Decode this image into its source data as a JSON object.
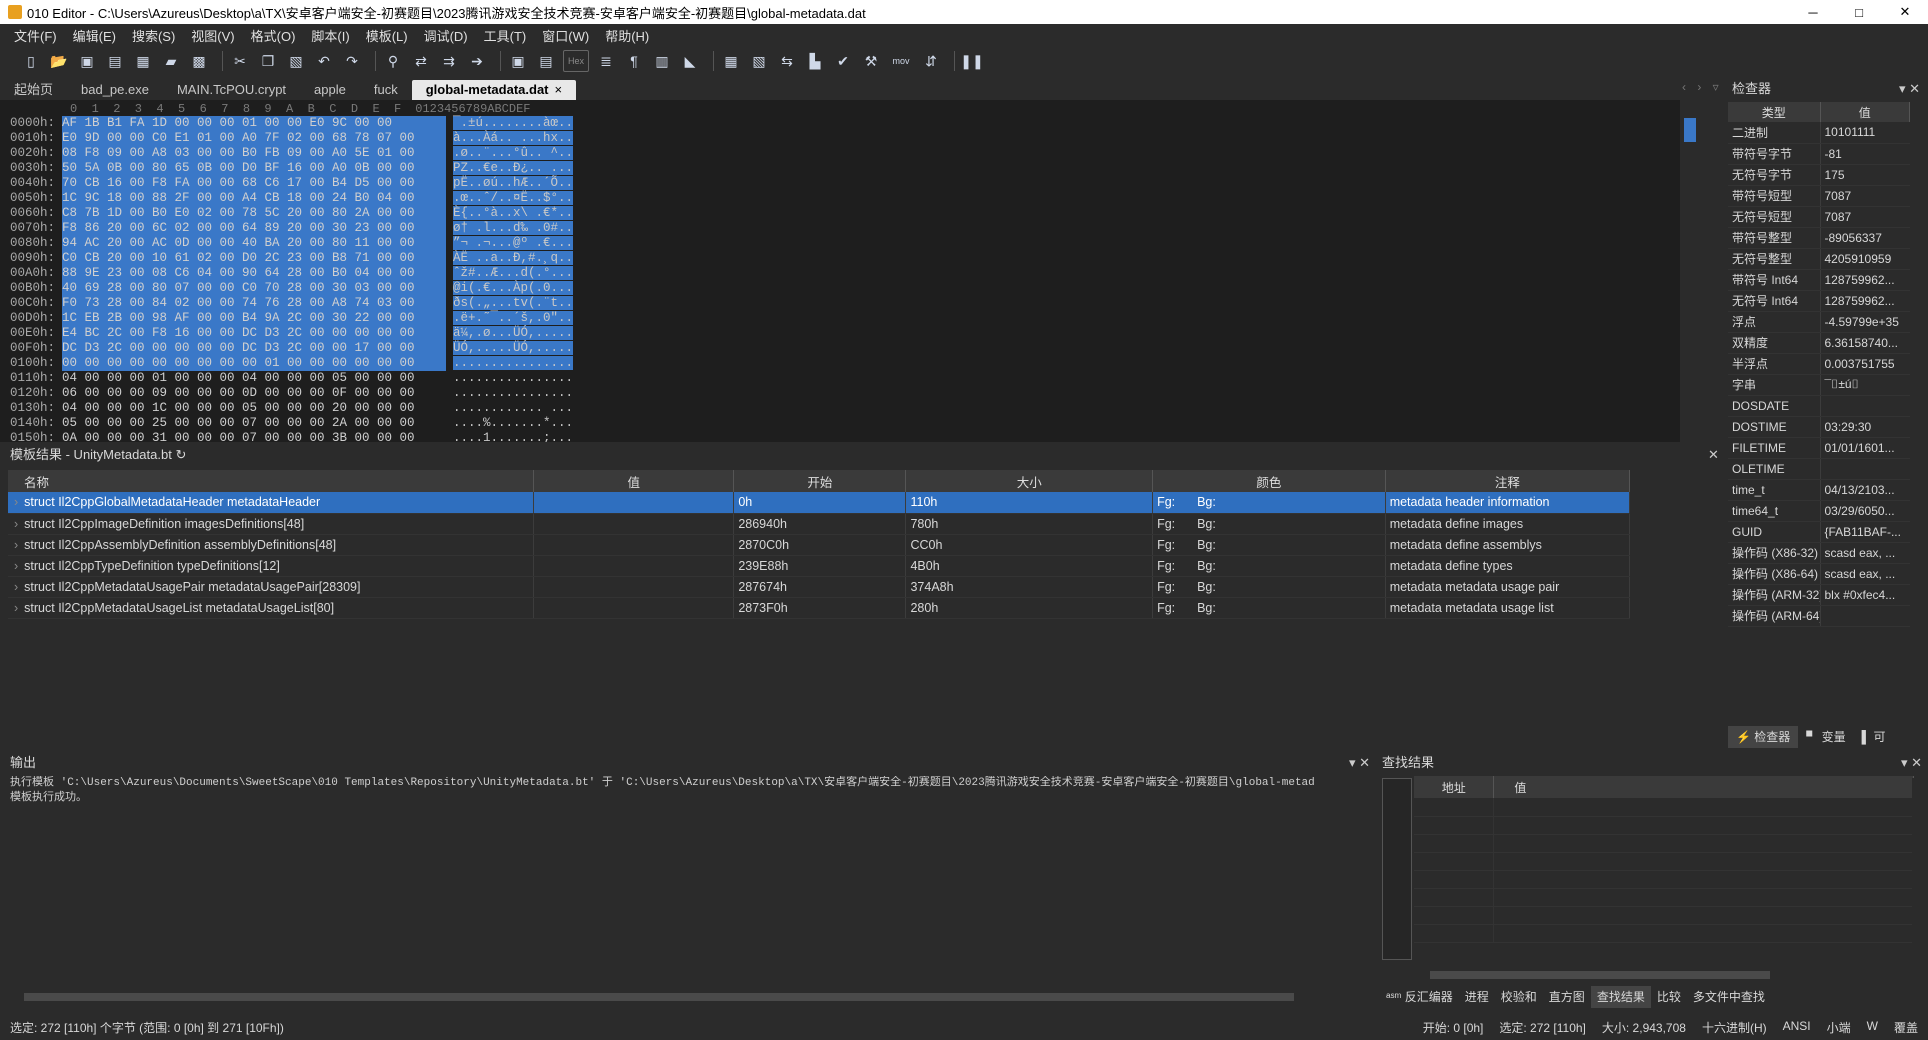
{
  "titlebar": {
    "title": "010 Editor - C:\\Users\\Azureus\\Desktop\\a\\TX\\安卓客户端安全-初赛题目\\2023腾讯游戏安全技术竞赛-安卓客户端安全-初赛题目\\global-metadata.dat",
    "minimize": "─",
    "maximize": "□",
    "close": "✕"
  },
  "menu": [
    "文件(F)",
    "编辑(E)",
    "搜索(S)",
    "视图(V)",
    "格式(O)",
    "脚本(I)",
    "模板(L)",
    "调试(D)",
    "工具(T)",
    "窗口(W)",
    "帮助(H)"
  ],
  "toolbar": {
    "hex_label": "Hex",
    "mov_label": "mov",
    "icons": [
      "new-file-icon",
      "open-icon",
      "save-icon",
      "save-as-icon",
      "save-all-icon",
      "open-folder-icon",
      "workspace-icon",
      "cut-icon",
      "copy-icon",
      "paste-icon",
      "undo-icon",
      "redo-icon",
      "find-icon",
      "replace-icon",
      "find-in-files-icon",
      "goto-icon",
      "template-icon",
      "script-icon",
      "hex-icon",
      "columns-icon",
      "pilcrow-icon",
      "split-icon",
      "highlight-icon",
      "calculator-icon",
      "clipboard-icon",
      "compare-icon",
      "histogram-icon",
      "checksum-icon",
      "tool-icon",
      "disassembler-icon",
      "asm-icon",
      "pause-icon"
    ]
  },
  "tabs": [
    {
      "label": "起始页",
      "active": false
    },
    {
      "label": "bad_pe.exe",
      "active": false
    },
    {
      "label": "MAIN.TcPOU.crypt",
      "active": false
    },
    {
      "label": "apple",
      "active": false
    },
    {
      "label": "fuck",
      "active": false
    },
    {
      "label": "global-metadata.dat",
      "active": true
    }
  ],
  "tab_close": "×",
  "tab_nav": "‹ › ▿",
  "hex": {
    "header_offsets": "0  1  2  3  4  5  6  7  8  9  A  B  C  D  E  F",
    "header_ascii": "0123456789ABCDEF",
    "rows": [
      {
        "addr": "0000h:",
        "bytes": "AF 1B B1 FA 1D 00 00 00 01 00 00 E0 9C 00 00",
        "ascii": "¯.±ú........àœ..",
        "sel": true
      },
      {
        "addr": "0010h:",
        "bytes": "E0 9D 00 00 C0 E1 01 00 A0 7F 02 00 68 78 07 00",
        "ascii": "à...Àá.. ...hx..",
        "sel": true
      },
      {
        "addr": "0020h:",
        "bytes": "08 F8 09 00 A8 03 00 00 B0 FB 09 00 A0 5E 01 00",
        "ascii": ".ø..¨...°û.. ^..",
        "sel": true
      },
      {
        "addr": "0030h:",
        "bytes": "50 5A 0B 00 80 65 0B 00 D0 BF 16 00 A0 0B 00 00",
        "ascii": "PZ..€e..Ð¿.. ...",
        "sel": true
      },
      {
        "addr": "0040h:",
        "bytes": "70 CB 16 00 F8 FA 00 00 68 C6 17 00 B4 D5 00 00",
        "ascii": "pË..øú..hÆ..´Õ..",
        "sel": true
      },
      {
        "addr": "0050h:",
        "bytes": "1C 9C 18 00 88 2F 00 00 A4 CB 18 00 24 B0 04 00",
        "ascii": ".œ..ˆ/..¤Ë..$°..",
        "sel": true
      },
      {
        "addr": "0060h:",
        "bytes": "C8 7B 1D 00 B0 E0 02 00 78 5C 20 00 80 2A 00 00",
        "ascii": "È{..°à..x\\ .€*..",
        "sel": true
      },
      {
        "addr": "0070h:",
        "bytes": "F8 86 20 00 6C 02 00 00 64 89 20 00 30 23 00 00",
        "ascii": "ø† .l...d‰ .0#..",
        "sel": true
      },
      {
        "addr": "0080h:",
        "bytes": "94 AC 20 00 AC 0D 00 00 40 BA 20 00 80 11 00 00",
        "ascii": "”¬ .¬...@º .€...",
        "sel": true
      },
      {
        "addr": "0090h:",
        "bytes": "C0 CB 20 00 10 61 02 00 D0 2C 23 00 B8 71 00 00",
        "ascii": "ÀË ..a..Ð,#.¸q..",
        "sel": true
      },
      {
        "addr": "00A0h:",
        "bytes": "88 9E 23 00 08 C6 04 00 90 64 28 00 B0 04 00 00",
        "ascii": "ˆž#..Æ...d(.°...",
        "sel": true
      },
      {
        "addr": "00B0h:",
        "bytes": "40 69 28 00 80 07 00 00 C0 70 28 00 30 03 00 00",
        "ascii": "@i(.€...Àp(.0...",
        "sel": true
      },
      {
        "addr": "00C0h:",
        "bytes": "F0 73 28 00 84 02 00 00 74 76 28 00 A8 74 03 00",
        "ascii": "ðs(.„...tv(.¨t..",
        "sel": true
      },
      {
        "addr": "00D0h:",
        "bytes": "1C EB 2B 00 98 AF 00 00 B4 9A 2C 00 30 22 00 00",
        "ascii": ".ë+.˜¯..´š,.0\"..",
        "sel": true
      },
      {
        "addr": "00E0h:",
        "bytes": "E4 BC 2C 00 F8 16 00 00 DC D3 2C 00 00 00 00 00",
        "ascii": "ä¼,.ø...ÜÓ,.....",
        "sel": true
      },
      {
        "addr": "00F0h:",
        "bytes": "DC D3 2C 00 00 00 00 00 DC D3 2C 00 00 17 00 00",
        "ascii": "ÜÓ,.....ÜÓ,.....",
        "sel": true
      },
      {
        "addr": "0100h:",
        "bytes": "00 00 00 00 00 00 00 00 00 01 00 00 00 00 00 00",
        "ascii": "................",
        "sel": true
      },
      {
        "addr": "0110h:",
        "bytes": "04 00 00 00 01 00 00 00 04 00 00 00 05 00 00 00",
        "ascii": "................",
        "sel": false
      },
      {
        "addr": "0120h:",
        "bytes": "06 00 00 00 09 00 00 00 0D 00 00 00 0F 00 00 00",
        "ascii": "................",
        "sel": false
      },
      {
        "addr": "0130h:",
        "bytes": "04 00 00 00 1C 00 00 00 05 00 00 00 20 00 00 00",
        "ascii": "............ ...",
        "sel": false
      },
      {
        "addr": "0140h:",
        "bytes": "05 00 00 00 25 00 00 00 07 00 00 00 2A 00 00 00",
        "ascii": "....%.......*...",
        "sel": false
      },
      {
        "addr": "0150h:",
        "bytes": "0A 00 00 00 31 00 00 00 07 00 00 00 3B 00 00 00",
        "ascii": "....1.......;...",
        "sel": false
      }
    ]
  },
  "template": {
    "title": "模板结果 - UnityMetadata.bt",
    "refresh": "↻",
    "close": "✕",
    "columns": [
      "名称",
      "值",
      "开始",
      "大小",
      "颜色",
      "注释"
    ],
    "rows": [
      {
        "name": "struct Il2CppGlobalMetadataHeader metadataHeader",
        "value": "",
        "start": "0h",
        "size": "110h",
        "fg": "Fg:",
        "bg": "Bg:",
        "comment": "metadata header information",
        "selected": true
      },
      {
        "name": "struct Il2CppImageDefinition imagesDefinitions[48]",
        "value": "",
        "start": "286940h",
        "size": "780h",
        "fg": "Fg:",
        "bg": "Bg:",
        "comment": "metadata define images",
        "selected": false
      },
      {
        "name": "struct Il2CppAssemblyDefinition assemblyDefinitions[48]",
        "value": "",
        "start": "2870C0h",
        "size": "CC0h",
        "fg": "Fg:",
        "bg": "Bg:",
        "comment": "metadata define assemblys",
        "selected": false
      },
      {
        "name": "struct Il2CppTypeDefinition typeDefinitions[12]",
        "value": "",
        "start": "239E88h",
        "size": "4B0h",
        "fg": "Fg:",
        "bg": "Bg:",
        "comment": "metadata define types",
        "selected": false
      },
      {
        "name": "struct Il2CppMetadataUsagePair metadataUsagePair[28309]",
        "value": "",
        "start": "287674h",
        "size": "374A8h",
        "fg": "Fg:",
        "bg": "Bg:",
        "comment": "metadata metadata usage pair",
        "selected": false
      },
      {
        "name": "struct Il2CppMetadataUsageList metadataUsageList[80]",
        "value": "",
        "start": "2873F0h",
        "size": "280h",
        "fg": "Fg:",
        "bg": "Bg:",
        "comment": "metadata metadata usage list",
        "selected": false
      }
    ]
  },
  "inspector": {
    "title": "检查器",
    "ctrl": "▾ ✕",
    "columns": [
      "类型",
      "值"
    ],
    "rows": [
      {
        "type": "二进制",
        "value": "10101111"
      },
      {
        "type": "带符号字节",
        "value": "-81"
      },
      {
        "type": "无符号字节",
        "value": "175"
      },
      {
        "type": "带符号短型",
        "value": "7087"
      },
      {
        "type": "无符号短型",
        "value": "7087"
      },
      {
        "type": "带符号整型",
        "value": "-89056337"
      },
      {
        "type": "无符号整型",
        "value": "4205910959"
      },
      {
        "type": "带符号 Int64",
        "value": "128759962..."
      },
      {
        "type": "无符号 Int64",
        "value": "128759962..."
      },
      {
        "type": "浮点",
        "value": "-4.59799e+35"
      },
      {
        "type": "双精度",
        "value": "6.36158740..."
      },
      {
        "type": "半浮点",
        "value": "0.003751755"
      },
      {
        "type": "字串",
        "value": "¯⌷±ú⌷"
      },
      {
        "type": "DOSDATE",
        "value": ""
      },
      {
        "type": "DOSTIME",
        "value": "03:29:30"
      },
      {
        "type": "FILETIME",
        "value": "01/01/1601..."
      },
      {
        "type": "OLETIME",
        "value": ""
      },
      {
        "type": "time_t",
        "value": "04/13/2103..."
      },
      {
        "type": "time64_t",
        "value": "03/29/6050..."
      },
      {
        "type": "GUID",
        "value": "{FAB11BAF-..."
      },
      {
        "type": "操作码 (X86-32)",
        "value": "scasd eax, ..."
      },
      {
        "type": "操作码 (X86-64)",
        "value": "scasd eax, ..."
      },
      {
        "type": "操作码 (ARM-32)",
        "value": "blx #0xfec4..."
      },
      {
        "type": "操作码 (ARM-64)",
        "value": ""
      }
    ],
    "tabs": [
      "⚡ 检查器",
      "▘ 变量",
      "▌ 可"
    ]
  },
  "output": {
    "title": "输出",
    "ctrl": "▾ ✕",
    "lines": [
      "执行模板 'C:\\Users\\Azureus\\Documents\\SweetScape\\010 Templates\\Repository\\UnityMetadata.bt' 于 'C:\\Users\\Azureus\\Desktop\\a\\TX\\安卓客户端安全-初赛题目\\2023腾讯游戏安全技术竞赛-安卓客户端安全-初赛题目\\global-metad",
      "模板执行成功。"
    ]
  },
  "find": {
    "title": "查找结果",
    "ctrl": "▾ ✕",
    "columns": [
      "地址",
      "值"
    ]
  },
  "bottom_tabs": [
    "ᵃˢᵐ 反汇编器",
    "进程",
    "校验和",
    "直方图",
    "查找结果",
    "比较",
    "多文件中查找"
  ],
  "status": {
    "left": "选定: 272 [110h] 个字节 (范围: 0 [0h] 到 271 [10Fh])",
    "start": "开始: 0 [0h]",
    "selected": "选定: 272 [110h]",
    "size": "大小: 2,943,708",
    "encoding_mode": "十六进制(H)",
    "charset": "ANSI",
    "endian": "小端",
    "mode": "W",
    "overwrite": "覆盖"
  }
}
